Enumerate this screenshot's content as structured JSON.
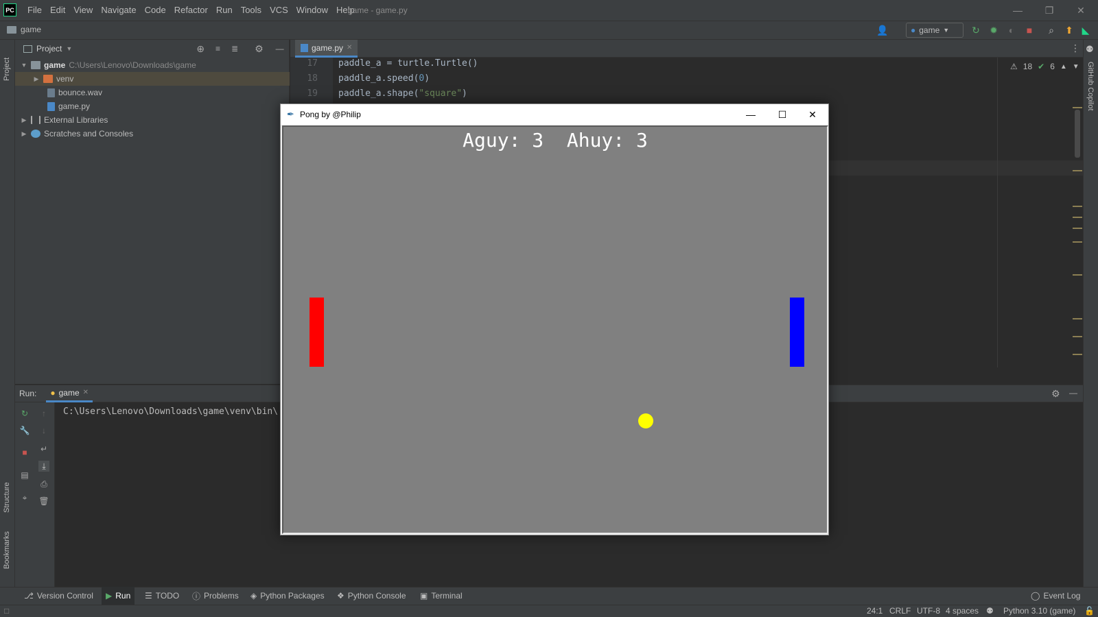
{
  "ide": {
    "logo": "PC",
    "menu": [
      "File",
      "Edit",
      "View",
      "Navigate",
      "Code",
      "Refactor",
      "Run",
      "Tools",
      "VCS",
      "Window",
      "Help"
    ],
    "window_title": "game - game.py",
    "nav_project": "game",
    "run_config": "game"
  },
  "left_stripe": {
    "project": "Project",
    "structure": "Structure",
    "bookmarks": "Bookmarks"
  },
  "right_stripe": {
    "copilot": "GitHub Copilot"
  },
  "project": {
    "header": "Project",
    "tree": [
      {
        "name": "game",
        "path": "C:\\Users\\Lenovo\\Downloads\\game"
      },
      {
        "name": "venv"
      },
      {
        "name": "bounce.wav"
      },
      {
        "name": "game.py"
      },
      {
        "name": "External Libraries"
      },
      {
        "name": "Scratches and Consoles"
      }
    ]
  },
  "editor": {
    "tab": "game.py",
    "inspection": {
      "warnings": "18",
      "ok": "6"
    },
    "lines": [
      {
        "num": "17",
        "pre": "paddle_a = turtle.Turtle()"
      },
      {
        "num": "18",
        "pre": "paddle_a.speed(",
        "arg": "0",
        "post": ")"
      },
      {
        "num": "19",
        "pre": "paddle_a.shape(",
        "arg": "\"square\"",
        "post": ")"
      }
    ]
  },
  "run": {
    "label": "Run:",
    "tab": "game",
    "console": "C:\\Users\\Lenovo\\Downloads\\game\\venv\\bin\\"
  },
  "bottom_tabs": [
    "Version Control",
    "Run",
    "TODO",
    "Problems",
    "Python Packages",
    "Python Console",
    "Terminal"
  ],
  "event_log": "Event Log",
  "status": {
    "position": "24:1",
    "line_sep": "CRLF",
    "encoding": "UTF-8",
    "indent": "4 spaces",
    "interpreter": "Python 3.10 (game)"
  },
  "pong": {
    "title": "Pong by @Philip",
    "score_text": "Aguy: 3  Ahuy: 3",
    "colors": {
      "background": "#808080",
      "paddle_a": "#ff0000",
      "paddle_b": "#0000ff",
      "ball": "#ffff00",
      "text": "#ffffff"
    }
  }
}
